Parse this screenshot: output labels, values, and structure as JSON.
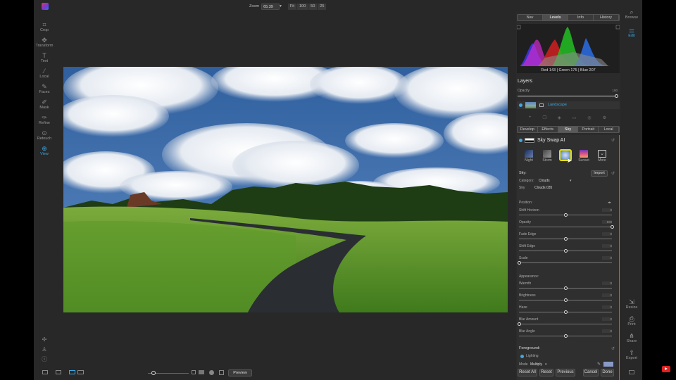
{
  "app": {
    "tools": [
      {
        "label": "Crop",
        "icon": "crop-icon"
      },
      {
        "label": "Transform",
        "icon": "transform-icon"
      },
      {
        "label": "Text",
        "icon": "text-icon"
      },
      {
        "label": "Local",
        "icon": "brush-icon"
      },
      {
        "label": "Faces",
        "icon": "faces-icon"
      },
      {
        "label": "Mask",
        "icon": "mask-icon"
      },
      {
        "label": "Refine",
        "icon": "refine-icon"
      },
      {
        "label": "Retouch",
        "icon": "retouch-icon"
      },
      {
        "label": "View",
        "icon": "view-icon"
      }
    ],
    "accent": "#3fa8e0"
  },
  "toolbar": {
    "zoom_label": "Zoom",
    "zoom_value": "65.39",
    "zoom_presets": [
      "Fit",
      "100",
      "50",
      "25"
    ],
    "preview_label": "Preview"
  },
  "panel": {
    "tabs": [
      "Nav",
      "Levels",
      "Info",
      "History"
    ],
    "active_tab": "Levels",
    "histogram_readout": "Red 143 | Green 175 | Blue 207",
    "layers_title": "Layers",
    "opacity_label": "Opacity",
    "opacity_value": "100",
    "layer_name": "Landscape",
    "module_tabs": [
      "Develop",
      "Effects",
      "Sky",
      "Portrait",
      "Local"
    ],
    "active_module": "Sky",
    "sky_card": {
      "title": "Sky Swap AI",
      "presets": [
        "Night",
        "Storm",
        "",
        "Sunset",
        "More"
      ],
      "sky_label": "Sky:",
      "import_label": "Import",
      "category_label": "Category:",
      "category_value": "Clouds",
      "sky_value_label": "Sky",
      "sky_value": "Clouds 035",
      "position_label": "Position:",
      "sliders_top": [
        {
          "label": "Shift Horizon",
          "value": "0",
          "level": 0.5
        },
        {
          "label": "Opacity",
          "value": "100",
          "level": 1.0
        },
        {
          "label": "Fade Edge",
          "value": "0",
          "level": 0.5
        },
        {
          "label": "Shift Edge",
          "value": "0",
          "level": 0.5
        },
        {
          "label": "Scale",
          "value": "0",
          "level": 0.0
        }
      ],
      "appearance_label": "Appearance:",
      "sliders_bottom": [
        {
          "label": "Warmth",
          "value": "0",
          "level": 0.5
        },
        {
          "label": "Brightness",
          "value": "0",
          "level": 0.5
        },
        {
          "label": "Haze",
          "value": "0",
          "level": 0.5
        },
        {
          "label": "Blur Amount",
          "value": "0",
          "level": 0.0
        },
        {
          "label": "Blur Angle",
          "value": "0",
          "level": 0.5
        }
      ],
      "foreground_label": "Foreground:",
      "lighting_label": "Lighting",
      "mode_label": "Mode",
      "mode_value": "Multiply"
    },
    "footer_buttons": [
      "Reset All",
      "Reset",
      "Previous",
      "Cancel",
      "Done"
    ]
  },
  "right_rail": [
    {
      "label": "Browse",
      "icon": "browse-icon"
    },
    {
      "label": "Edit",
      "icon": "edit-icon"
    },
    {
      "label": "Resize",
      "icon": "resize-icon"
    },
    {
      "label": "Print",
      "icon": "print-icon"
    },
    {
      "label": "Share",
      "icon": "share-icon"
    },
    {
      "label": "Export",
      "icon": "export-icon"
    }
  ]
}
